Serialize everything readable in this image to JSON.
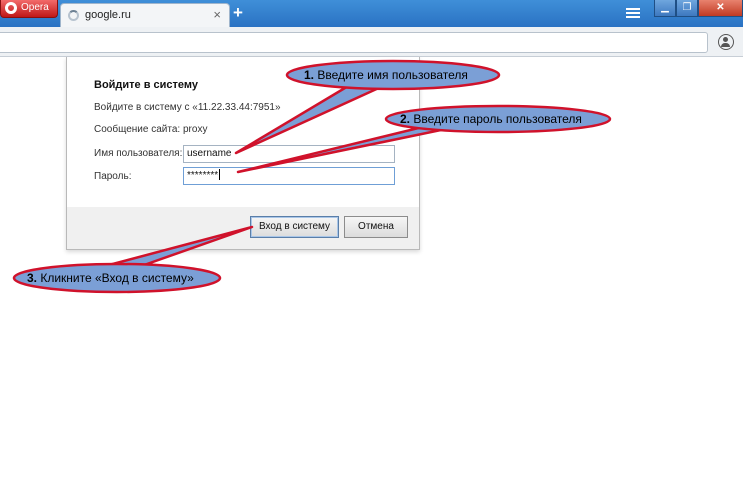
{
  "browser": {
    "menu_label": "Opera",
    "tab_title": "google.ru",
    "tab_close": "×",
    "new_tab": "+",
    "window_controls": {
      "minimize": "▁",
      "maximize": "❐",
      "close": "✕"
    }
  },
  "dialog": {
    "title": "Войдите в систему",
    "server_text": "Войдите в систему с «11.22.33.44:7951»",
    "message_label": "Сообщение сайта:",
    "message_value": "proxy",
    "username_label": "Имя пользователя:",
    "username_value": "username",
    "password_label": "Пароль:",
    "password_value": "********",
    "login_button": "Вход в систему",
    "cancel_button": "Отмена"
  },
  "callouts": [
    {
      "number": "1.",
      "text": "Введите имя пользователя"
    },
    {
      "number": "2.",
      "text": "Введите пароль пользователя"
    },
    {
      "number": "3.",
      "text": "Кликните «Вход в систему»"
    }
  ],
  "colors": {
    "callout_fill": "#7b9fd6",
    "callout_border": "#d0122b",
    "titlebar": "#2f7fcf"
  }
}
